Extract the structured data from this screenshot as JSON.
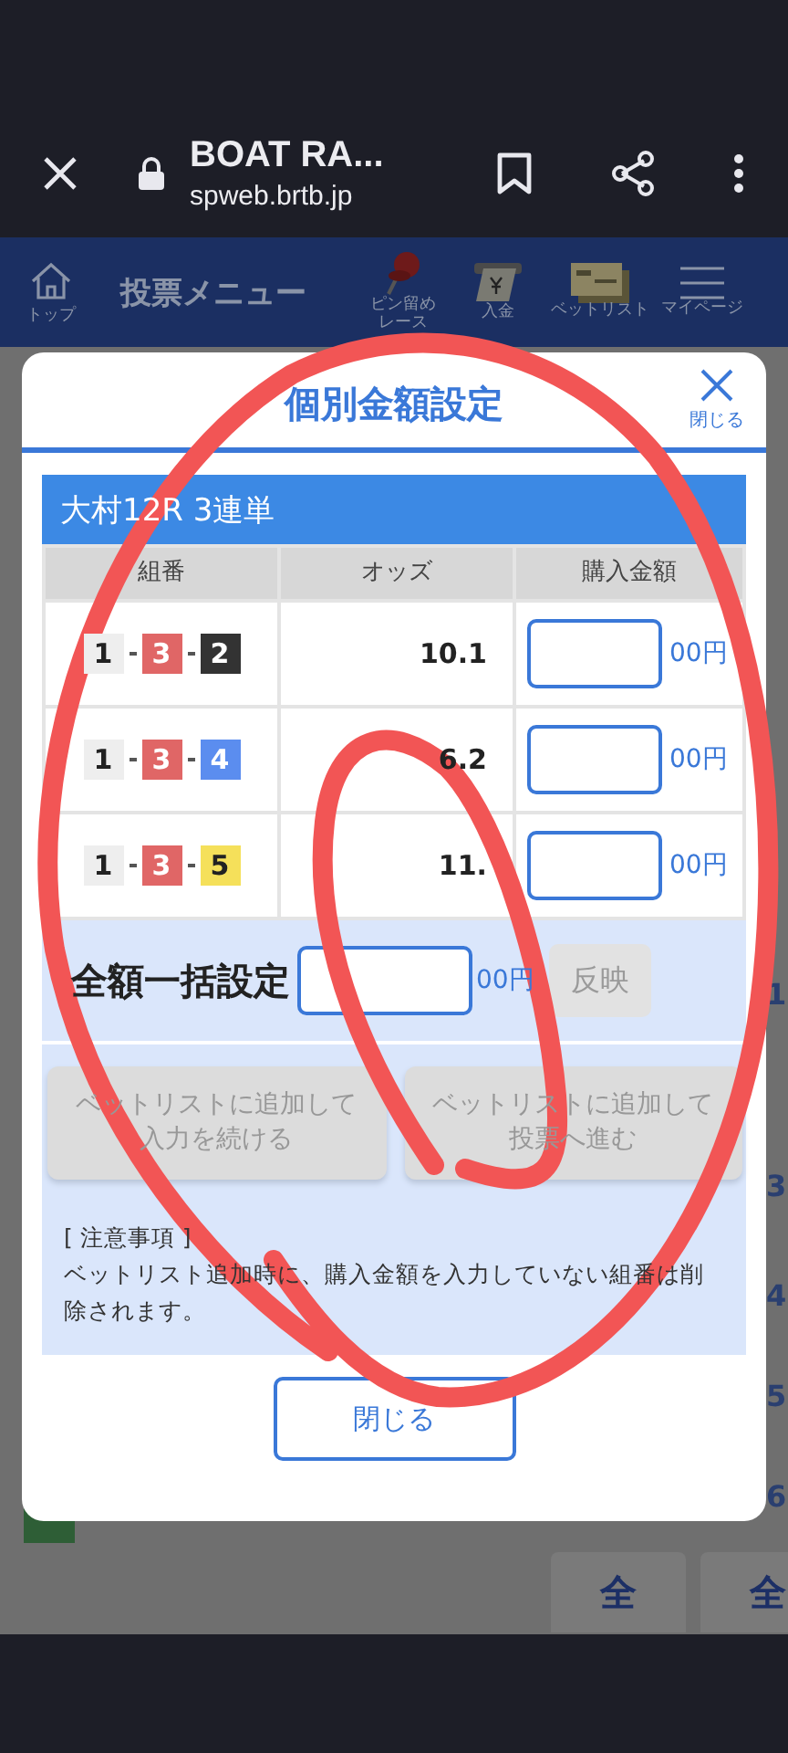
{
  "browser": {
    "title": "BOAT RA...",
    "url": "spweb.brtb.jp"
  },
  "nav": {
    "home_label": "トップ",
    "title": "投票メニュー",
    "items": [
      {
        "kind": "pin",
        "label": "ピン留めレース"
      },
      {
        "kind": "deposit",
        "label": "入金"
      },
      {
        "kind": "betlist",
        "label": "ベットリスト"
      },
      {
        "kind": "menu",
        "label": "マイページ"
      }
    ]
  },
  "background_page": {
    "fragments": [
      "1",
      "3",
      "4",
      "5",
      "6"
    ],
    "buttons": [
      "全",
      "全"
    ]
  },
  "modal": {
    "title": "個別金額設定",
    "close_label": "閉じる",
    "race_header": "大村12R  3連単",
    "columns": [
      "組番",
      "オッズ",
      "購入金額"
    ],
    "rows": [
      {
        "combo": [
          {
            "num": "1",
            "color": "#eeeeee"
          },
          {
            "num": "3",
            "color": "#e06666"
          },
          {
            "num": "2",
            "color": "#333333"
          }
        ],
        "odds": "10.1",
        "unit": "00円"
      },
      {
        "combo": [
          {
            "num": "1",
            "color": "#eeeeee"
          },
          {
            "num": "3",
            "color": "#e06666"
          },
          {
            "num": "4",
            "color": "#5b8def"
          }
        ],
        "odds": "6.2",
        "unit": "00円"
      },
      {
        "combo": [
          {
            "num": "1",
            "color": "#eeeeee"
          },
          {
            "num": "3",
            "color": "#e06666"
          },
          {
            "num": "5",
            "color": "#f5e05a"
          }
        ],
        "odds": "11.",
        "unit": "00円"
      }
    ],
    "bulk": {
      "label": "全額一括設定",
      "unit": "00円",
      "button": "反映",
      "disabled": true
    },
    "actions": [
      {
        "label": "ベットリストに追加して入力を続ける",
        "disabled": true
      },
      {
        "label": "ベットリストに追加して投票へ進む",
        "disabled": true
      }
    ],
    "notes": {
      "heading": "[ 注意事項 ]",
      "body": "ベットリスト追加時に、購入金額を入力していない組番は削除されます。"
    },
    "close_button": "閉じる"
  }
}
